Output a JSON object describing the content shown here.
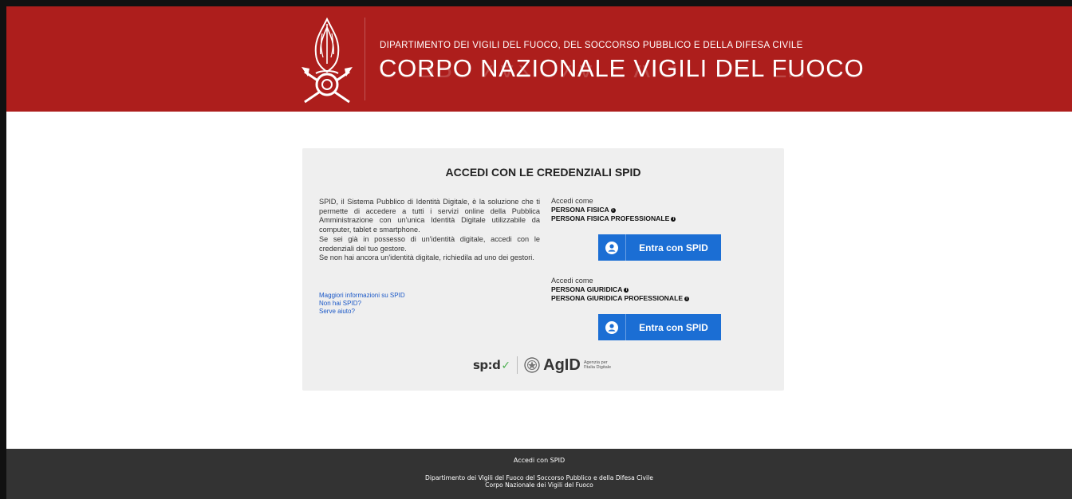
{
  "header": {
    "department": "DIPARTIMENTO DEI VIGILI DEL FUOCO, DEL SOCCORSO PUBBLICO E DELLA DIFESA CIVILE",
    "corps": "CORPO NAZIONALE VIGILI DEL FUOCO",
    "background_color": "#ad1e1c"
  },
  "card": {
    "title": "ACCEDI CON LE CREDENZIALI SPID",
    "intro": [
      "SPID, il Sistema Pubblico di Identità Digitale, è la soluzione che ti permette di accedere a tutti i servizi online della Pubblica Amministrazione con un'unica Identità Digitale utilizzabile da computer, tablet e smartphone.",
      "Se sei già in possesso di un'identità digitale, accedi con le credenziali del tuo gestore.",
      "Se non hai ancora un'identità digitale, richiedila ad uno dei gestori."
    ],
    "links": [
      "Maggiori informazioni su SPID",
      "Non hai SPID?",
      "Serve aiuto?"
    ],
    "access_physical": {
      "label": "Accedi come",
      "roles": [
        "PERSONA FISICA",
        "PERSONA FISICA PROFESSIONALE"
      ],
      "button": "Entra con SPID"
    },
    "access_legal": {
      "label": "Accedi come",
      "roles": [
        "PERSONA GIURIDICA",
        "PERSONA GIURIDICA PROFESSIONALE"
      ],
      "button": "Entra con SPID"
    },
    "logos": {
      "spid": "sp:d",
      "agid": "AgID",
      "agid_sub_1": "Agenzia per",
      "agid_sub_2": "l'Italia Digitale"
    },
    "button_color": "#1b6ed4"
  },
  "footer": {
    "title": "Accedi con SPID",
    "line1": "Dipartimento dei Vigili del Fuoco del Soccorso Pubblico e della Difesa Civile",
    "line2": "Corpo Nazionale dei Vigili del Fuoco",
    "background_color": "#333333"
  },
  "icons": [
    "vvf-emblem-icon",
    "info-icon",
    "user-icon",
    "spid-check-icon",
    "agid-seal-icon"
  ]
}
